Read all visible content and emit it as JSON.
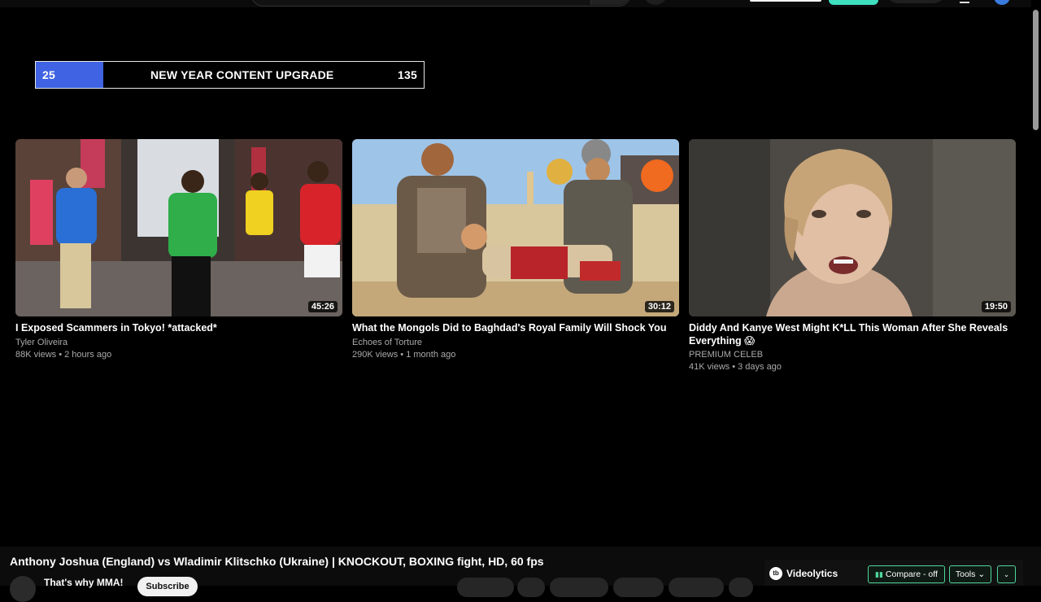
{
  "banner": {
    "start": "25",
    "title": "NEW YEAR CONTENT UPGRADE",
    "end": "135",
    "fill_color": "#3f63e2",
    "progress": 0.175
  },
  "videos": [
    {
      "title": "I Exposed Scammers in Tokyo! *attacked*",
      "channel": "Tyler Oliveira",
      "meta": "88K views • 2 hours ago",
      "duration": "45:26"
    },
    {
      "title": "What the Mongols Did to Baghdad's Royal Family Will Shock You",
      "channel": "Echoes of Torture",
      "meta": "290K views • 1 month ago",
      "duration": "30:12"
    },
    {
      "title": "Diddy And Kanye West Might K*LL This Woman After She Reveals Everything 😱",
      "channel": "PREMIUM CELEB",
      "meta": "41K views • 3 days ago",
      "duration": "19:50"
    }
  ],
  "player": {
    "title": "Anthony Joshua (England) vs Wladimir Klitschko (Ukraine) | KNOCKOUT, BOXING fight, HD, 60 fps",
    "channel": "That's why MMA!",
    "subscribe_label": "Subscribe"
  },
  "videolytics": {
    "logo_text": "tb",
    "name": "Videolytics",
    "compare_label": "Compare - off",
    "tools_label": "Tools",
    "tools_caret": "⌄",
    "expand_icon": "⌄",
    "accent": "#4fd69c"
  }
}
